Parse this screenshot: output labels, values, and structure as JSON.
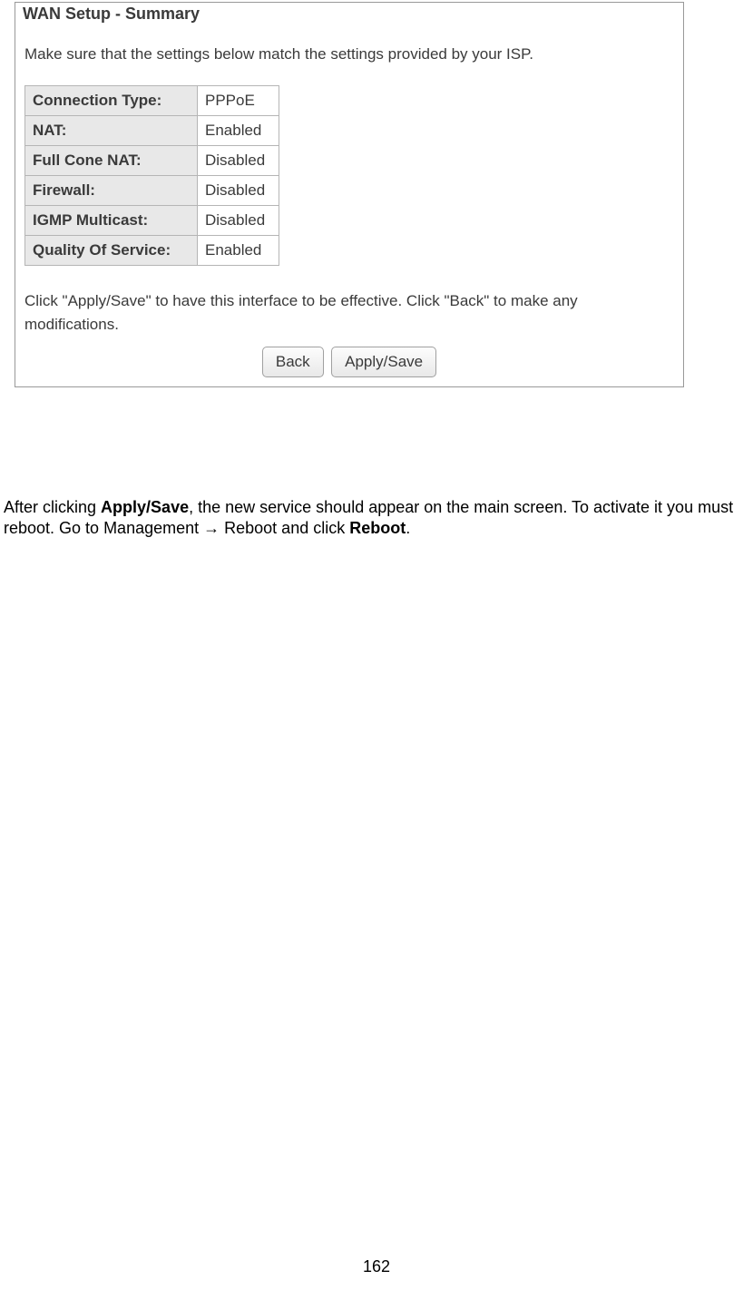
{
  "panel": {
    "title": "WAN Setup - Summary",
    "instruction": "Make sure that the settings below match the settings provided by your ISP.",
    "rows": [
      {
        "label": "Connection Type:",
        "value": "PPPoE"
      },
      {
        "label": "NAT:",
        "value": "Enabled"
      },
      {
        "label": "Full Cone NAT:",
        "value": "Disabled"
      },
      {
        "label": "Firewall:",
        "value": "Disabled"
      },
      {
        "label": "IGMP Multicast:",
        "value": "Disabled"
      },
      {
        "label": "Quality Of Service:",
        "value": "Enabled"
      }
    ],
    "help": "Click \"Apply/Save\" to have this interface to be effective. Click \"Back\" to make any modifications.",
    "buttons": {
      "back": "Back",
      "apply": "Apply/Save"
    }
  },
  "doc": {
    "before_bold1": "After clicking ",
    "bold1": "Apply/Save",
    "middle": ", the new service should appear on the main screen. To activate it you must reboot. Go to Management ",
    "arrow": "→",
    "after_arrow": " Reboot and click ",
    "bold2": "Reboot",
    "end": "."
  },
  "page_number": "162"
}
